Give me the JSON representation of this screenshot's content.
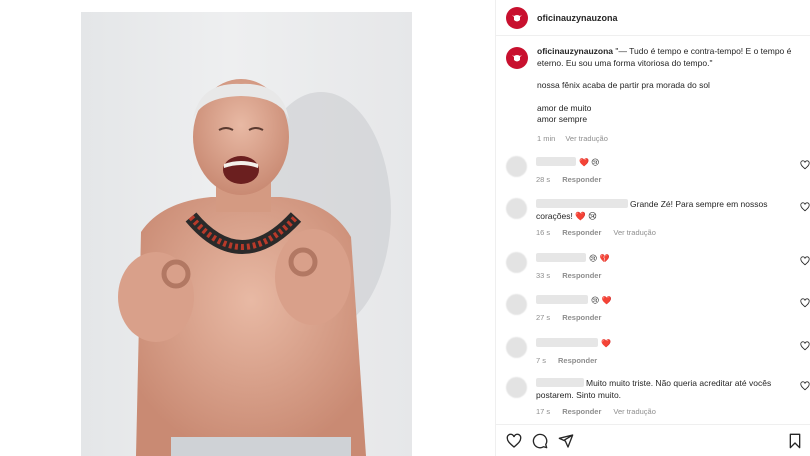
{
  "post": {
    "username": "oficinauzynauzona",
    "caption": {
      "username": "oficinauzynauzona",
      "line1": "\"— Tudo é tempo e contra-tempo! E o tempo é eterno. Eu sou uma forma vitoriosa do tempo.\"",
      "line2": "nossa fênix acaba de partir pra morada do sol",
      "line3": "amor de muito",
      "line4": "amor sempre",
      "time": "1 min",
      "translate": "Ver tradução"
    }
  },
  "comments": [
    {
      "text": "",
      "emojis": "❤️ 😢",
      "time": "28 s",
      "reply": "Responder",
      "translate": ""
    },
    {
      "text": "Grande Zé! Para sempre em nossos corações! ❤️ 😢",
      "emojis": "",
      "time": "16 s",
      "reply": "Responder",
      "translate": "Ver tradução"
    },
    {
      "text": "",
      "emojis": "😢 💔",
      "time": "33 s",
      "reply": "Responder",
      "translate": ""
    },
    {
      "text": "",
      "emojis": "😢 ❤️",
      "time": "27 s",
      "reply": "Responder",
      "translate": ""
    },
    {
      "text": "",
      "emojis": "❤️",
      "time": "7 s",
      "reply": "Responder",
      "translate": ""
    },
    {
      "text": "Muito muito triste. Não queria acreditar até vocês postarem. Sinto muito.",
      "emojis": "",
      "time": "17 s",
      "reply": "Responder",
      "translate": "Ver tradução"
    }
  ],
  "icons": {
    "like": "heart-icon",
    "comment": "comment-icon",
    "share": "share-icon",
    "save": "bookmark-icon",
    "comment_like": "heart-icon"
  },
  "colors": {
    "brand": "#c8102e",
    "text": "#262626",
    "muted": "#8e8e8e"
  }
}
